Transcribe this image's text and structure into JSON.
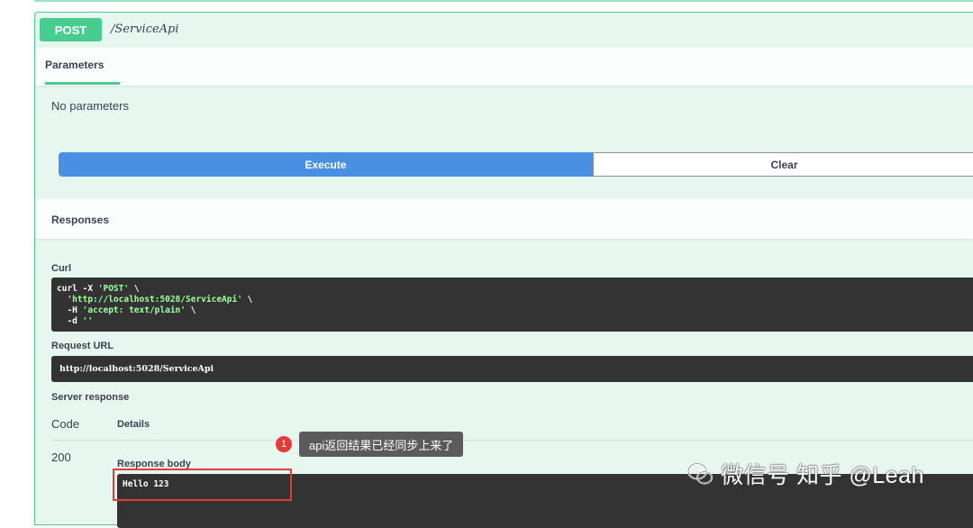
{
  "operation": {
    "method": "POST",
    "path": "/ServiceApi"
  },
  "parameters": {
    "tab_label": "Parameters",
    "empty_text": "No parameters"
  },
  "buttons": {
    "execute": "Execute",
    "clear": "Clear"
  },
  "responses": {
    "title": "Responses",
    "curl_label": "Curl",
    "curl_lines": [
      {
        "cmd": "curl -X ",
        "str": "'POST'",
        "tail": " \\"
      },
      {
        "cmd": "  ",
        "str": "'http://localhost:5028/ServiceApi'",
        "tail": " \\"
      },
      {
        "cmd": "  -H ",
        "str": "'accept: text/plain'",
        "tail": " \\"
      },
      {
        "cmd": "  -d ",
        "str": "''",
        "tail": ""
      }
    ],
    "request_url_label": "Request URL",
    "request_url": "http://localhost:5028/ServiceApi",
    "server_response_label": "Server response",
    "code_header": "Code",
    "details_header": "Details",
    "status_code": "200",
    "response_body_label": "Response body",
    "response_body": "Hello 123"
  },
  "annotation": {
    "number": "1",
    "text": "api返回结果已经同步上来了"
  },
  "watermark": {
    "text": "微信号 知乎 @Leah",
    "icon": "wechat-icon"
  },
  "colors": {
    "post_green": "#49cc90",
    "execute_blue": "#4990e2",
    "code_bg": "#333333",
    "highlight_red": "#e23b3b"
  }
}
